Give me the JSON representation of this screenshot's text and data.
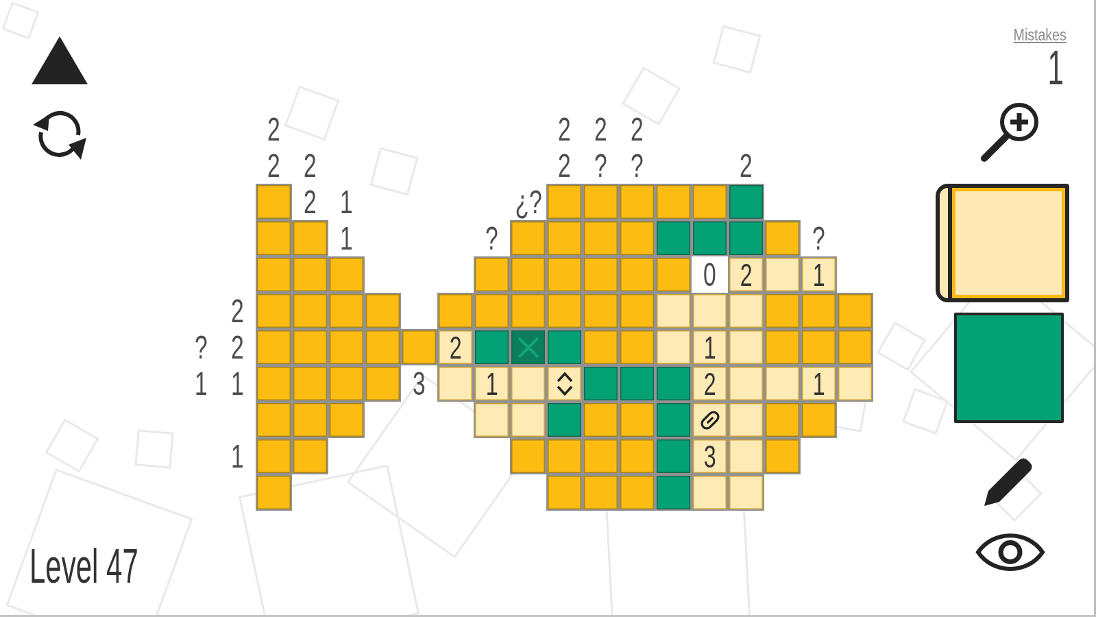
{
  "mistakes": {
    "label": "Mistakes",
    "count": "1"
  },
  "tools": [
    {
      "color": "#fee9b4",
      "selected": true
    },
    {
      "color": "#03a174",
      "selected": false
    }
  ],
  "board": {
    "rows": [
      [
        null,
        null,
        {
          "kind": "clue",
          "text": "2"
        },
        null,
        null,
        null,
        null,
        null,
        null,
        null,
        {
          "kind": "clue",
          "text": "2"
        },
        {
          "kind": "clue",
          "text": "2"
        },
        {
          "kind": "clue",
          "text": "2"
        },
        null,
        null,
        null,
        null,
        null,
        null
      ],
      [
        null,
        null,
        {
          "kind": "clue",
          "text": "2"
        },
        {
          "kind": "clue",
          "text": "2"
        },
        null,
        null,
        null,
        null,
        null,
        null,
        {
          "kind": "clue",
          "text": "2"
        },
        {
          "kind": "clue",
          "text": "?"
        },
        {
          "kind": "clue",
          "text": "?"
        },
        null,
        null,
        {
          "kind": "clue",
          "text": "2"
        },
        null,
        null,
        null
      ],
      [
        null,
        null,
        {
          "kind": "hidden"
        },
        {
          "kind": "clue",
          "text": "2"
        },
        {
          "kind": "clue",
          "text": "1"
        },
        null,
        null,
        null,
        null,
        {
          "kind": "clue",
          "text": "¿?"
        },
        {
          "kind": "hidden"
        },
        {
          "kind": "hidden"
        },
        {
          "kind": "hidden"
        },
        {
          "kind": "hidden"
        },
        {
          "kind": "hidden"
        },
        {
          "kind": "marked"
        },
        null,
        null,
        null
      ],
      [
        null,
        null,
        {
          "kind": "hidden"
        },
        {
          "kind": "hidden"
        },
        {
          "kind": "clue",
          "text": "1"
        },
        null,
        null,
        null,
        {
          "kind": "clue",
          "text": "?"
        },
        {
          "kind": "hidden"
        },
        {
          "kind": "hidden"
        },
        {
          "kind": "hidden"
        },
        {
          "kind": "hidden"
        },
        {
          "kind": "marked"
        },
        {
          "kind": "marked"
        },
        {
          "kind": "marked"
        },
        {
          "kind": "hidden"
        },
        {
          "kind": "clue",
          "text": "?"
        },
        null
      ],
      [
        null,
        null,
        {
          "kind": "hidden"
        },
        {
          "kind": "hidden"
        },
        {
          "kind": "hidden"
        },
        null,
        null,
        null,
        {
          "kind": "hidden"
        },
        {
          "kind": "hidden"
        },
        {
          "kind": "hidden"
        },
        {
          "kind": "hidden"
        },
        {
          "kind": "hidden"
        },
        {
          "kind": "hidden"
        },
        {
          "kind": "clue",
          "text": "0"
        },
        {
          "kind": "revealed",
          "text": "2"
        },
        {
          "kind": "revealed"
        },
        {
          "kind": "revealed",
          "text": "1"
        },
        null
      ],
      [
        null,
        {
          "kind": "clue",
          "text": "2"
        },
        {
          "kind": "hidden"
        },
        {
          "kind": "hidden"
        },
        {
          "kind": "hidden"
        },
        {
          "kind": "hidden"
        },
        null,
        {
          "kind": "hidden"
        },
        {
          "kind": "hidden"
        },
        {
          "kind": "hidden"
        },
        {
          "kind": "hidden"
        },
        {
          "kind": "hidden"
        },
        {
          "kind": "hidden"
        },
        {
          "kind": "revealed"
        },
        {
          "kind": "revealed"
        },
        {
          "kind": "revealed"
        },
        {
          "kind": "hidden"
        },
        {
          "kind": "hidden"
        },
        {
          "kind": "hidden"
        }
      ],
      [
        {
          "kind": "clue",
          "text": "?"
        },
        {
          "kind": "clue",
          "text": "2"
        },
        {
          "kind": "hidden"
        },
        {
          "kind": "hidden"
        },
        {
          "kind": "hidden"
        },
        {
          "kind": "hidden"
        },
        {
          "kind": "hidden"
        },
        {
          "kind": "revealed",
          "text": "2"
        },
        {
          "kind": "marked"
        },
        {
          "kind": "mistake"
        },
        {
          "kind": "marked"
        },
        {
          "kind": "hidden"
        },
        {
          "kind": "hidden"
        },
        {
          "kind": "revealed"
        },
        {
          "kind": "revealed",
          "text": "1"
        },
        {
          "kind": "revealed"
        },
        {
          "kind": "hidden"
        },
        {
          "kind": "hidden"
        },
        {
          "kind": "hidden"
        }
      ],
      [
        {
          "kind": "clue",
          "text": "1"
        },
        {
          "kind": "clue",
          "text": "1"
        },
        {
          "kind": "hidden"
        },
        {
          "kind": "hidden"
        },
        {
          "kind": "hidden"
        },
        {
          "kind": "hidden"
        },
        {
          "kind": "clue",
          "text": "3"
        },
        {
          "kind": "revealed"
        },
        {
          "kind": "revealed",
          "text": "1"
        },
        {
          "kind": "revealed"
        },
        {
          "kind": "chevrons"
        },
        {
          "kind": "marked"
        },
        {
          "kind": "marked"
        },
        {
          "kind": "marked"
        },
        {
          "kind": "revealed",
          "text": "2"
        },
        {
          "kind": "revealed"
        },
        {
          "kind": "revealed"
        },
        {
          "kind": "revealed",
          "text": "1"
        },
        {
          "kind": "revealed"
        }
      ],
      [
        null,
        null,
        {
          "kind": "hidden"
        },
        {
          "kind": "hidden"
        },
        {
          "kind": "hidden"
        },
        null,
        null,
        null,
        {
          "kind": "revealed"
        },
        {
          "kind": "revealed"
        },
        {
          "kind": "marked"
        },
        {
          "kind": "hidden"
        },
        {
          "kind": "hidden"
        },
        {
          "kind": "marked"
        },
        {
          "kind": "link"
        },
        {
          "kind": "revealed"
        },
        {
          "kind": "hidden"
        },
        {
          "kind": "hidden"
        },
        null
      ],
      [
        null,
        {
          "kind": "clue",
          "text": "1"
        },
        {
          "kind": "hidden"
        },
        {
          "kind": "hidden"
        },
        null,
        null,
        null,
        null,
        null,
        {
          "kind": "hidden"
        },
        {
          "kind": "hidden"
        },
        {
          "kind": "hidden"
        },
        {
          "kind": "hidden"
        },
        {
          "kind": "marked"
        },
        {
          "kind": "revealed",
          "text": "3"
        },
        {
          "kind": "revealed"
        },
        {
          "kind": "hidden"
        },
        null,
        null
      ],
      [
        null,
        null,
        {
          "kind": "hidden"
        },
        null,
        null,
        null,
        null,
        null,
        null,
        null,
        {
          "kind": "hidden"
        },
        {
          "kind": "hidden"
        },
        {
          "kind": "hidden"
        },
        {
          "kind": "marked"
        },
        {
          "kind": "revealed"
        },
        {
          "kind": "revealed"
        },
        null,
        null,
        null
      ]
    ]
  },
  "level": {
    "label": "Level 47"
  }
}
